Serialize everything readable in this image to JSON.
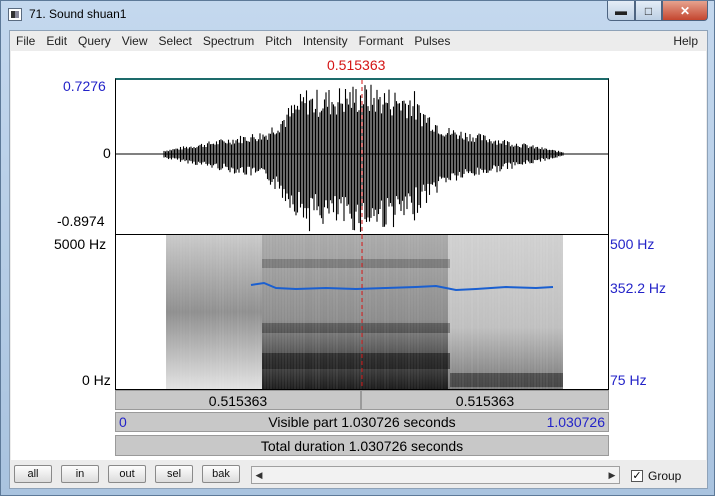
{
  "window": {
    "title": "71. Sound shuan1",
    "minimize": "▬",
    "maximize": "□",
    "close": "✕"
  },
  "menu": {
    "items": [
      "File",
      "Edit",
      "Query",
      "View",
      "Select",
      "Spectrum",
      "Pitch",
      "Intensity",
      "Formant",
      "Pulses"
    ],
    "help": "Help"
  },
  "cursor": {
    "time": "0.515363"
  },
  "waveform": {
    "max_label": "0.7276",
    "zero_label": "0",
    "min_label": "-0.8974"
  },
  "spectrogram": {
    "freq_top": "5000 Hz",
    "freq_bottom": "0 Hz"
  },
  "pitch": {
    "top": "500 Hz",
    "current": "352.2 Hz",
    "bottom": "75 Hz"
  },
  "time_bars": {
    "left_segment": "0.515363",
    "right_segment": "0.515363",
    "visible_start": "0",
    "visible_text": "Visible part 1.030726 seconds",
    "visible_end": "1.030726",
    "total_text": "Total duration 1.030726 seconds"
  },
  "buttons": {
    "all": "all",
    "in": "in",
    "out": "out",
    "sel": "sel",
    "bak": "bak"
  },
  "group": {
    "label": "Group",
    "checked": true,
    "check_mark": "✓"
  },
  "colors": {
    "cursor": "#d41414",
    "pitch_line": "#1a5fd0",
    "axis_labels": "#2323c8"
  }
}
